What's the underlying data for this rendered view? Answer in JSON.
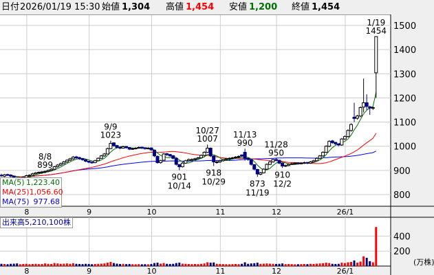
{
  "header": {
    "date_label": "日付",
    "datetime": "2026/01/19 15:30",
    "open_label": "始値",
    "open": "1,304",
    "high_label": "高値",
    "high": "1,454",
    "low_label": "安値",
    "low": "1,200",
    "close_label": "終値",
    "close": "1,454"
  },
  "legend": {
    "ma5_label": "MA(5)",
    "ma5": "1,223.40",
    "ma25_label": "MA(25)",
    "ma25": "1,056.60",
    "ma75_label": "MA(75)",
    "ma75": "977.68"
  },
  "volume_legend": {
    "label": "出来高",
    "value": "5,210,100株"
  },
  "colors": {
    "up_body": "#ffffff",
    "down_body": "#000080",
    "up_volume": "#ff0000",
    "down_volume": "#000080",
    "ma5": "#007000",
    "ma25": "#ff0000",
    "ma75": "#0000ff",
    "grid": "#cccccc"
  },
  "chart_data": {
    "type": "candlestick",
    "price_axis": {
      "ticks": [
        800,
        900,
        1000,
        1100,
        1200,
        1300,
        1400,
        1500
      ],
      "ylim": [
        765,
        1545
      ]
    },
    "volume_axis": {
      "ticks": [
        200,
        400
      ],
      "unit": "(万株)",
      "ylim": [
        0,
        520
      ]
    },
    "month_ticks": [
      {
        "label": "8",
        "date": "08/01"
      },
      {
        "label": "9",
        "date": "09/01"
      },
      {
        "label": "10",
        "date": "10/01"
      },
      {
        "label": "11",
        "date": "11/04"
      },
      {
        "label": "12",
        "date": "12/01"
      },
      {
        "label": "26/1",
        "date": "01/05"
      }
    ],
    "annotations": [
      {
        "date": "08/08",
        "text_date": "8/8",
        "value": "899",
        "pos": "above"
      },
      {
        "date": "09/09",
        "text_date": "9/9",
        "value": "1023",
        "pos": "above"
      },
      {
        "date": "10/14",
        "text_date": "10/14",
        "value": "901",
        "pos": "below"
      },
      {
        "date": "10/27",
        "text_date": "10/27",
        "value": "1007",
        "pos": "above"
      },
      {
        "date": "10/29",
        "text_date": "10/29",
        "value": "918",
        "pos": "below"
      },
      {
        "date": "11/13",
        "text_date": "11/13",
        "value": "990",
        "pos": "above"
      },
      {
        "date": "11/19",
        "text_date": "11/19",
        "value": "873",
        "pos": "below"
      },
      {
        "date": "11/28",
        "text_date": "11/28",
        "value": "950",
        "pos": "above"
      },
      {
        "date": "12/02",
        "text_date": "12/2",
        "value": "910",
        "pos": "below"
      },
      {
        "date": "01/19",
        "text_date": "1/19",
        "value": "1454",
        "pos": "above"
      }
    ],
    "candles_columns": [
      "date",
      "open",
      "high",
      "low",
      "close",
      "volume"
    ],
    "candles": [
      [
        "07/18",
        880,
        886,
        874,
        878,
        30
      ],
      [
        "07/22",
        876,
        885,
        872,
        882,
        28
      ],
      [
        "07/23",
        883,
        886,
        876,
        880,
        25
      ],
      [
        "07/24",
        881,
        884,
        872,
        876,
        30
      ],
      [
        "07/25",
        876,
        878,
        866,
        870,
        32
      ],
      [
        "07/28",
        870,
        872,
        858,
        862,
        35
      ],
      [
        "07/29",
        862,
        870,
        858,
        866,
        25
      ],
      [
        "07/30",
        865,
        876,
        862,
        872,
        28
      ],
      [
        "07/31",
        871,
        882,
        868,
        878,
        30
      ],
      [
        "08/01",
        877,
        884,
        874,
        880,
        25
      ],
      [
        "08/04",
        880,
        890,
        878,
        886,
        28
      ],
      [
        "08/05",
        886,
        893,
        883,
        890,
        30
      ],
      [
        "08/06",
        890,
        895,
        886,
        892,
        26
      ],
      [
        "08/07",
        891,
        897,
        886,
        894,
        28
      ],
      [
        "08/08",
        893,
        899,
        888,
        896,
        35
      ],
      [
        "08/12",
        896,
        904,
        892,
        900,
        30
      ],
      [
        "08/13",
        900,
        909,
        896,
        905,
        28
      ],
      [
        "08/14",
        905,
        919,
        902,
        915,
        40
      ],
      [
        "08/15",
        915,
        926,
        911,
        922,
        35
      ],
      [
        "08/18",
        922,
        932,
        918,
        928,
        30
      ],
      [
        "08/19",
        928,
        939,
        924,
        935,
        32
      ],
      [
        "08/20",
        935,
        946,
        931,
        942,
        35
      ],
      [
        "08/21",
        942,
        952,
        938,
        948,
        30
      ],
      [
        "08/22",
        948,
        959,
        944,
        955,
        38
      ],
      [
        "08/25",
        956,
        960,
        948,
        952,
        30
      ],
      [
        "08/26",
        953,
        956,
        944,
        948,
        28
      ],
      [
        "08/27",
        949,
        952,
        940,
        944,
        26
      ],
      [
        "08/28",
        944,
        946,
        934,
        938,
        30
      ],
      [
        "08/29",
        938,
        940,
        930,
        934,
        28
      ],
      [
        "09/01",
        934,
        938,
        928,
        932,
        25
      ],
      [
        "09/02",
        932,
        944,
        930,
        940,
        28
      ],
      [
        "09/03",
        940,
        954,
        938,
        950,
        30
      ],
      [
        "09/04",
        950,
        964,
        948,
        960,
        32
      ],
      [
        "09/05",
        960,
        972,
        956,
        968,
        35
      ],
      [
        "09/08",
        968,
        994,
        966,
        990,
        45
      ],
      [
        "09/09",
        990,
        1023,
        988,
        1012,
        55
      ],
      [
        "09/10",
        1014,
        1016,
        998,
        1002,
        40
      ],
      [
        "09/11",
        1003,
        1006,
        990,
        995,
        32
      ],
      [
        "09/12",
        996,
        998,
        988,
        992,
        28
      ],
      [
        "09/16",
        992,
        1002,
        990,
        998,
        30
      ],
      [
        "09/17",
        999,
        1001,
        990,
        994,
        26
      ],
      [
        "09/18",
        995,
        996,
        984,
        988,
        28
      ],
      [
        "09/19",
        988,
        994,
        985,
        990,
        25
      ],
      [
        "09/22",
        990,
        996,
        987,
        992,
        24
      ],
      [
        "09/24",
        992,
        999,
        990,
        995,
        26
      ],
      [
        "09/25",
        996,
        998,
        989,
        993,
        24
      ],
      [
        "09/26",
        994,
        995,
        986,
        990,
        25
      ],
      [
        "09/29",
        990,
        996,
        987,
        992,
        24
      ],
      [
        "09/30",
        993,
        995,
        981,
        985,
        28
      ],
      [
        "10/01",
        984,
        986,
        955,
        960,
        40
      ],
      [
        "10/02",
        958,
        962,
        928,
        932,
        45
      ],
      [
        "10/03",
        932,
        944,
        928,
        940,
        32
      ],
      [
        "10/06",
        942,
        972,
        940,
        968,
        40
      ],
      [
        "10/07",
        969,
        972,
        960,
        965,
        30
      ],
      [
        "10/08",
        966,
        968,
        956,
        960,
        28
      ],
      [
        "10/09",
        961,
        963,
        946,
        950,
        30
      ],
      [
        "10/10",
        950,
        952,
        920,
        925,
        40
      ],
      [
        "10/14",
        924,
        926,
        901,
        915,
        45
      ],
      [
        "10/15",
        915,
        934,
        912,
        930,
        32
      ],
      [
        "10/16",
        930,
        944,
        927,
        940,
        30
      ],
      [
        "10/17",
        940,
        949,
        936,
        945,
        28
      ],
      [
        "10/20",
        945,
        950,
        940,
        945,
        26
      ],
      [
        "10/21",
        945,
        952,
        942,
        948,
        28
      ],
      [
        "10/22",
        948,
        956,
        944,
        952,
        26
      ],
      [
        "10/23",
        952,
        966,
        949,
        962,
        30
      ],
      [
        "10/24",
        962,
        979,
        958,
        975,
        35
      ],
      [
        "10/27",
        975,
        1007,
        972,
        992,
        50
      ],
      [
        "10/28",
        992,
        995,
        955,
        960,
        45
      ],
      [
        "10/29",
        960,
        962,
        918,
        935,
        48
      ],
      [
        "10/30",
        934,
        940,
        928,
        935,
        30
      ],
      [
        "10/31",
        935,
        944,
        931,
        940,
        28
      ],
      [
        "11/04",
        940,
        949,
        936,
        945,
        26
      ],
      [
        "11/05",
        945,
        952,
        941,
        948,
        25
      ],
      [
        "11/06",
        948,
        954,
        944,
        950,
        24
      ],
      [
        "11/07",
        950,
        956,
        946,
        952,
        26
      ],
      [
        "11/10",
        952,
        959,
        948,
        955,
        28
      ],
      [
        "11/11",
        955,
        962,
        951,
        958,
        26
      ],
      [
        "11/12",
        964,
        966,
        955,
        960,
        30
      ],
      [
        "11/13",
        975,
        990,
        940,
        950,
        50
      ],
      [
        "11/14",
        950,
        952,
        940,
        945,
        30
      ],
      [
        "11/17",
        944,
        946,
        920,
        925,
        35
      ],
      [
        "11/18",
        924,
        926,
        900,
        905,
        38
      ],
      [
        "11/19",
        904,
        906,
        873,
        885,
        45
      ],
      [
        "11/20",
        884,
        894,
        880,
        890,
        30
      ],
      [
        "11/21",
        890,
        909,
        887,
        905,
        32
      ],
      [
        "11/25",
        905,
        929,
        902,
        925,
        35
      ],
      [
        "11/26",
        925,
        939,
        922,
        935,
        32
      ],
      [
        "11/27",
        935,
        948,
        932,
        945,
        30
      ],
      [
        "11/28",
        945,
        950,
        938,
        942,
        28
      ],
      [
        "12/01",
        942,
        944,
        926,
        930,
        30
      ],
      [
        "12/02",
        930,
        932,
        910,
        918,
        35
      ],
      [
        "12/03",
        918,
        924,
        914,
        920,
        26
      ],
      [
        "12/04",
        920,
        929,
        917,
        925,
        28
      ],
      [
        "12/05",
        925,
        932,
        922,
        928,
        26
      ],
      [
        "12/08",
        928,
        934,
        925,
        930,
        24
      ],
      [
        "12/09",
        931,
        933,
        924,
        928,
        25
      ],
      [
        "12/10",
        928,
        934,
        925,
        930,
        26
      ],
      [
        "12/11",
        930,
        936,
        927,
        932,
        28
      ],
      [
        "12/12",
        933,
        935,
        926,
        930,
        26
      ],
      [
        "12/15",
        930,
        939,
        927,
        935,
        30
      ],
      [
        "12/16",
        935,
        944,
        932,
        940,
        28
      ],
      [
        "12/17",
        940,
        954,
        937,
        950,
        32
      ],
      [
        "12/18",
        950,
        964,
        946,
        960,
        35
      ],
      [
        "12/19",
        960,
        979,
        956,
        975,
        38
      ],
      [
        "12/22",
        975,
        1004,
        972,
        1000,
        45
      ],
      [
        "12/23",
        1000,
        1025,
        996,
        1020,
        40
      ],
      [
        "12/24",
        1022,
        1026,
        1010,
        1015,
        30
      ],
      [
        "12/25",
        1016,
        1018,
        1006,
        1010,
        28
      ],
      [
        "12/26",
        1010,
        1012,
        1000,
        1005,
        30
      ],
      [
        "12/29",
        1005,
        1034,
        1002,
        1030,
        45
      ],
      [
        "12/30",
        1030,
        1045,
        1026,
        1040,
        40
      ],
      [
        "01/05",
        1040,
        1070,
        1036,
        1065,
        50
      ],
      [
        "01/06",
        1065,
        1095,
        1060,
        1090,
        55
      ],
      [
        "01/07",
        1120,
        1180,
        1100,
        1115,
        75
      ],
      [
        "01/08",
        1116,
        1130,
        1110,
        1125,
        45
      ],
      [
        "01/09",
        1125,
        1165,
        1120,
        1160,
        60
      ],
      [
        "01/13",
        1162,
        1280,
        1140,
        1180,
        130
      ],
      [
        "01/14",
        1180,
        1215,
        1150,
        1165,
        110
      ],
      [
        "01/15",
        1163,
        1168,
        1130,
        1158,
        65
      ],
      [
        "01/16",
        1160,
        1163,
        1150,
        1160,
        50
      ],
      [
        "01/19",
        1304,
        1454,
        1200,
        1454,
        521
      ]
    ]
  }
}
